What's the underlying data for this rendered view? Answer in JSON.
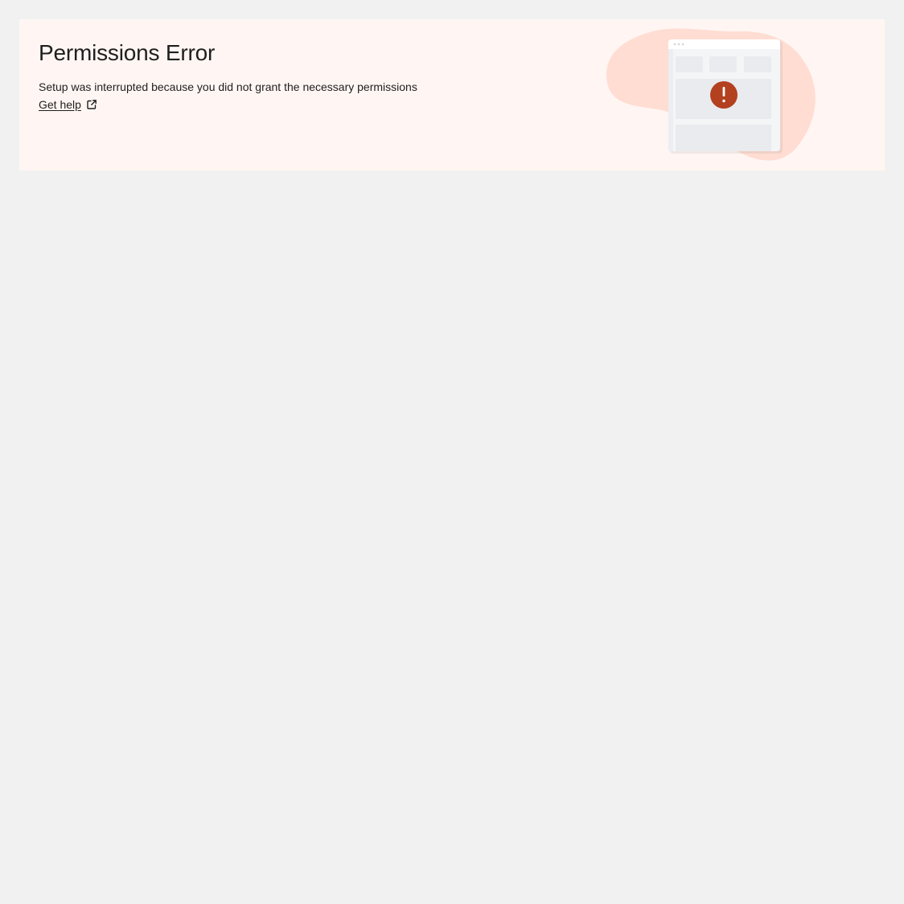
{
  "banner": {
    "title": "Permissions Error",
    "message": "Setup was interrupted because you did not grant the necessary permissions",
    "help_link_label": "Get help",
    "help_link_icon": "external-link-icon"
  },
  "illustration": {
    "icon": "error-window-illustration",
    "alert_glyph": "!",
    "colors": {
      "blob": "#ffddd3",
      "window": "#f4f5f7",
      "panel": "#e9ebee",
      "alert": "#b3401f"
    }
  },
  "colors": {
    "page_background": "#f1f1f1",
    "banner_background": "#fff6f3",
    "text": "#1f1f1f"
  }
}
